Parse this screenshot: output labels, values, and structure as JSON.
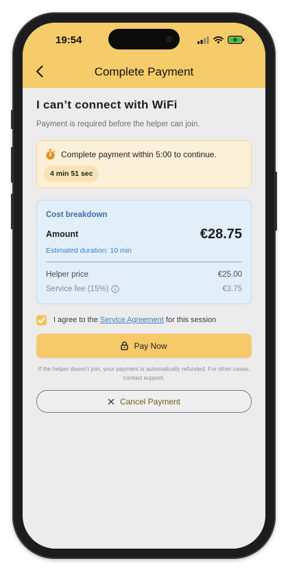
{
  "status_bar": {
    "time": "19:54"
  },
  "nav": {
    "title": "Complete Payment",
    "back_icon": "chevron-left-icon"
  },
  "issue": {
    "title": "I can’t connect with WiFi",
    "subtitle": "Payment is required before the helper can join."
  },
  "timer": {
    "icon": "stopwatch-icon",
    "message": "Complete payment within 5:00 to continue.",
    "countdown": "4 min 51 sec"
  },
  "cost": {
    "heading": "Cost breakdown",
    "amount_label": "Amount",
    "amount_value": "€28.75",
    "duration": "Estimated duration: 10 min",
    "helper_label": "Helper price",
    "helper_value": "€25.00",
    "fee_label": "Service fee (15%)",
    "fee_value": "€3.75"
  },
  "agreement": {
    "checked": true,
    "prefix": "I agree to the",
    "link": "Service Agreement",
    "suffix": "for this session"
  },
  "pay_button": {
    "label": "Pay Now"
  },
  "refund_note": "If the helper doesn’t join, your payment is automatically refunded. For other cases, contact support.",
  "cancel_button": {
    "label": "Cancel Payment"
  },
  "colors": {
    "header": "#f6cb6a",
    "primary_button": "#f6c969",
    "link": "#3c7fc0"
  }
}
